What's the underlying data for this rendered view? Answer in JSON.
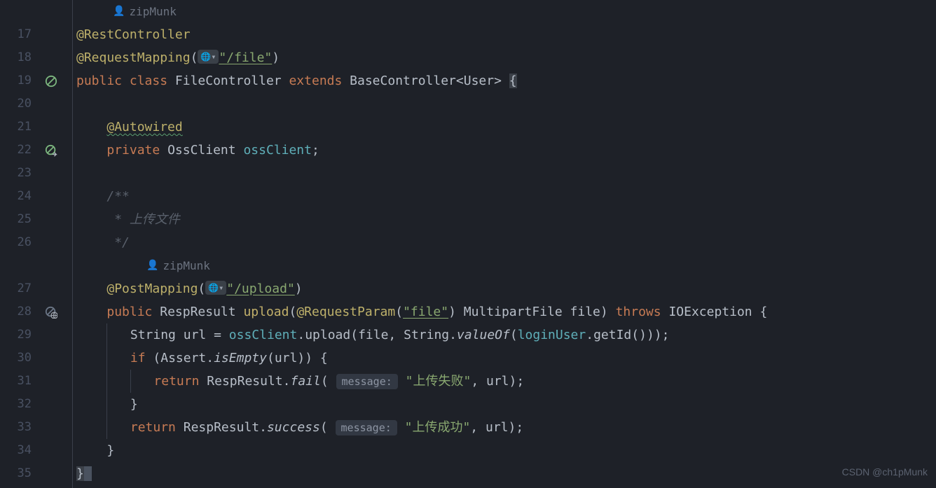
{
  "author1": "zipMunk",
  "author2": "zipMunk",
  "watermark": "CSDN @ch1pMunk",
  "lines": {
    "l17": "17",
    "l18": "18",
    "l19": "19",
    "l20": "20",
    "l21": "21",
    "l22": "22",
    "l23": "23",
    "l24": "24",
    "l25": "25",
    "l26": "26",
    "l27": "27",
    "l28": "28",
    "l29": "29",
    "l30": "30",
    "l31": "31",
    "l32": "32",
    "l33": "33",
    "l34": "34",
    "l35": "35"
  },
  "code": {
    "anno_restcontroller": "@RestController",
    "anno_requestmapping": "@RequestMapping",
    "path_file": "\"/file\"",
    "kw_public": "public",
    "kw_class": "class",
    "class_filecontroller": "FileController",
    "kw_extends": "extends",
    "class_basecontroller": "BaseController",
    "lt": "<",
    "gt": ">",
    "type_user": "User",
    "brace_open": "{",
    "brace_close": "}",
    "anno_autowired": "@Autowired",
    "kw_private": "private",
    "type_ossclient": "OssClient",
    "field_ossclient": "ossClient",
    "semi": ";",
    "comment_open": "/**",
    "comment_body": " * 上传文件",
    "comment_close": " */",
    "anno_postmapping": "@PostMapping",
    "path_upload": "\"/upload\"",
    "type_respresult": "RespResult",
    "method_upload": "upload",
    "anno_requestparam": "@RequestParam",
    "str_file": "\"file\"",
    "type_multipartfile": "MultipartFile",
    "param_file": "file",
    "kw_throws": "throws",
    "type_ioexception": "IOException",
    "type_string": "String",
    "var_url": "url",
    "eq": "=",
    "dot": ".",
    "call_upload": "upload",
    "comma": ",",
    "call_valueof": "valueOf",
    "field_loginuser": "loginUser",
    "call_getid": "getId",
    "paren_open": "(",
    "paren_close": ")",
    "kw_if": "if",
    "class_assert": "Assert",
    "call_isempty": "isEmpty",
    "kw_return": "return",
    "call_fail": "fail",
    "inlay_message": "message:",
    "str_fail": "\"上传失败\"",
    "call_success": "success",
    "str_success": "\"上传成功\""
  }
}
